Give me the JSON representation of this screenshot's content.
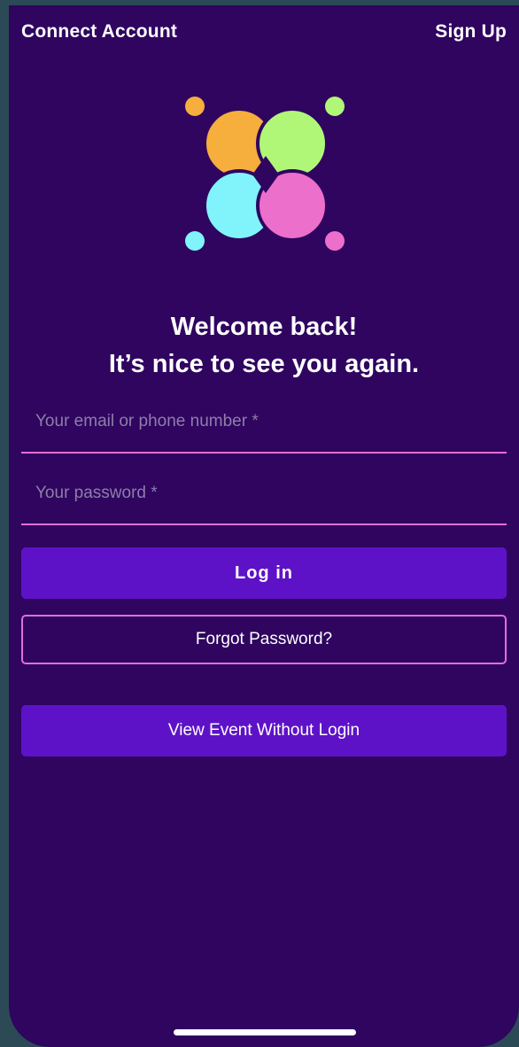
{
  "nav": {
    "connect_account": "Connect Account",
    "sign_up": "Sign Up"
  },
  "logo": {
    "icon": "four-circles-logo-icon",
    "colors": {
      "orange": "#f6ae3c",
      "green": "#b1f777",
      "cyan": "#80f4fa",
      "pink": "#ec6fcb"
    }
  },
  "welcome": {
    "line1": "Welcome back!",
    "line2": "It’s nice to see you again."
  },
  "form": {
    "email_placeholder": "Your email or phone number *",
    "password_placeholder": "Your password *",
    "login_label": "Log in",
    "forgot_label": "Forgot Password?",
    "view_event_label": "View Event Without Login"
  },
  "theme": {
    "background": "#2f0560",
    "button": "#5e12c8",
    "accent": "#e46fd4"
  }
}
